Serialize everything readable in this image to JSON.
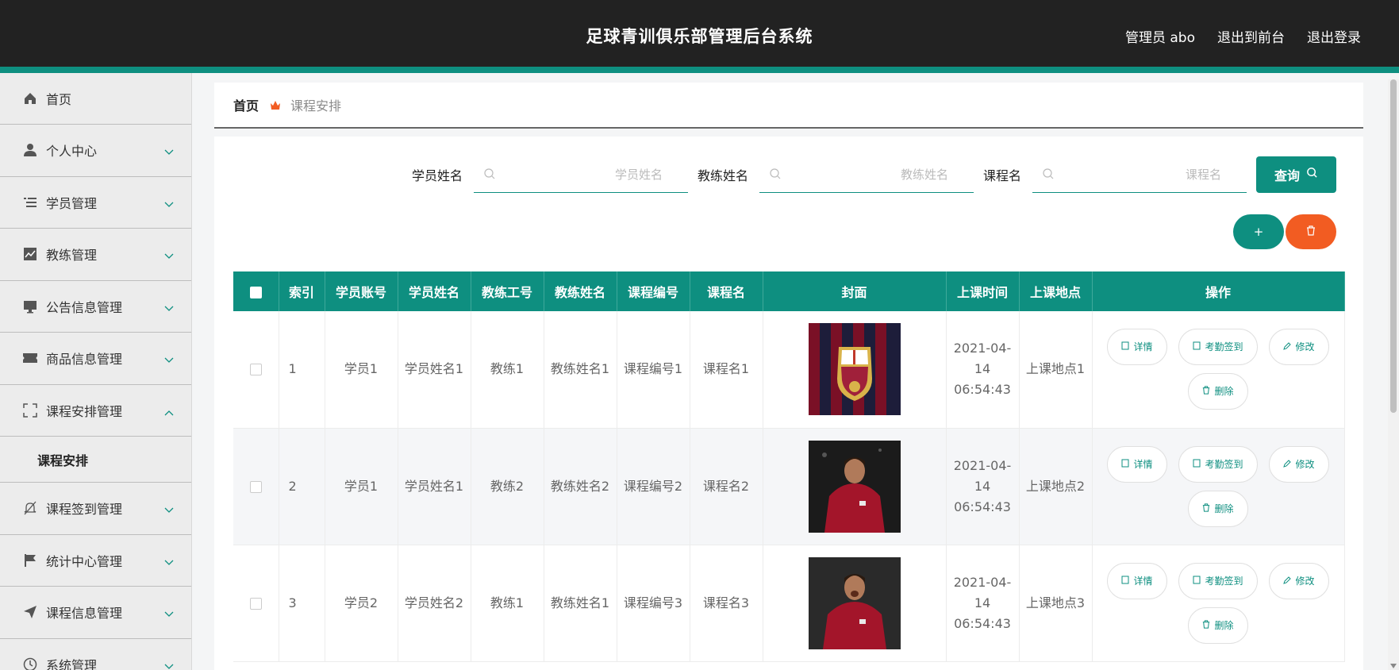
{
  "header": {
    "title": "足球青训俱乐部管理后台系统",
    "admin": "管理员 abo",
    "exit_front": "退出到前台",
    "logout": "退出登录"
  },
  "sidebar": {
    "items": [
      {
        "label": "首页",
        "icon": "home-icon"
      },
      {
        "label": "个人中心",
        "icon": "user-icon"
      },
      {
        "label": "学员管理",
        "icon": "list-icon"
      },
      {
        "label": "教练管理",
        "icon": "chart-icon"
      },
      {
        "label": "公告信息管理",
        "icon": "monitor-icon"
      },
      {
        "label": "商品信息管理",
        "icon": "ticket-icon"
      },
      {
        "label": "课程安排管理",
        "icon": "fullscreen-icon"
      },
      {
        "label": "课程签到管理",
        "icon": "bell-off-icon"
      },
      {
        "label": "统计中心管理",
        "icon": "flag-icon"
      },
      {
        "label": "课程信息管理",
        "icon": "send-icon"
      },
      {
        "label": "系统管理",
        "icon": "clock-icon"
      }
    ],
    "sub_item": "课程安排"
  },
  "breadcrumb": {
    "home": "首页",
    "current": "课程安排"
  },
  "search": {
    "student_label": "学员姓名",
    "student_placeholder": "学员姓名",
    "coach_label": "教练姓名",
    "coach_placeholder": "教练姓名",
    "course_label": "课程名",
    "course_placeholder": "课程名",
    "query": "查询"
  },
  "actions": {
    "add": "+",
    "delete_icon": "trash-icon"
  },
  "table": {
    "headers": [
      "索引",
      "学员账号",
      "学员姓名",
      "教练工号",
      "教练姓名",
      "课程编号",
      "课程名",
      "封面",
      "上课时间",
      "上课地点",
      "操作"
    ],
    "op_labels": {
      "detail": "详情",
      "attend": "考勤签到",
      "edit": "修改",
      "remove": "删除"
    },
    "rows": [
      {
        "index": "1",
        "student_account": "学员1",
        "student_name": "学员姓名1",
        "coach_no": "教练1",
        "coach_name": "教练姓名1",
        "course_no": "课程编号1",
        "course_name": "课程名1",
        "time": "2021-04-14 06:54:43",
        "place": "上课地点1"
      },
      {
        "index": "2",
        "student_account": "学员1",
        "student_name": "学员姓名1",
        "coach_no": "教练2",
        "coach_name": "教练姓名2",
        "course_no": "课程编号2",
        "course_name": "课程名2",
        "time": "2021-04-14 06:54:43",
        "place": "上课地点2"
      },
      {
        "index": "3",
        "student_account": "学员2",
        "student_name": "学员姓名2",
        "coach_no": "教练1",
        "coach_name": "教练姓名1",
        "course_no": "课程编号3",
        "course_name": "课程名3",
        "time": "2021-04-14 06:54:43",
        "place": "上课地点3"
      }
    ]
  },
  "colors": {
    "accent": "#0e8f80",
    "danger": "#f25c22",
    "header_bg": "#222222"
  }
}
